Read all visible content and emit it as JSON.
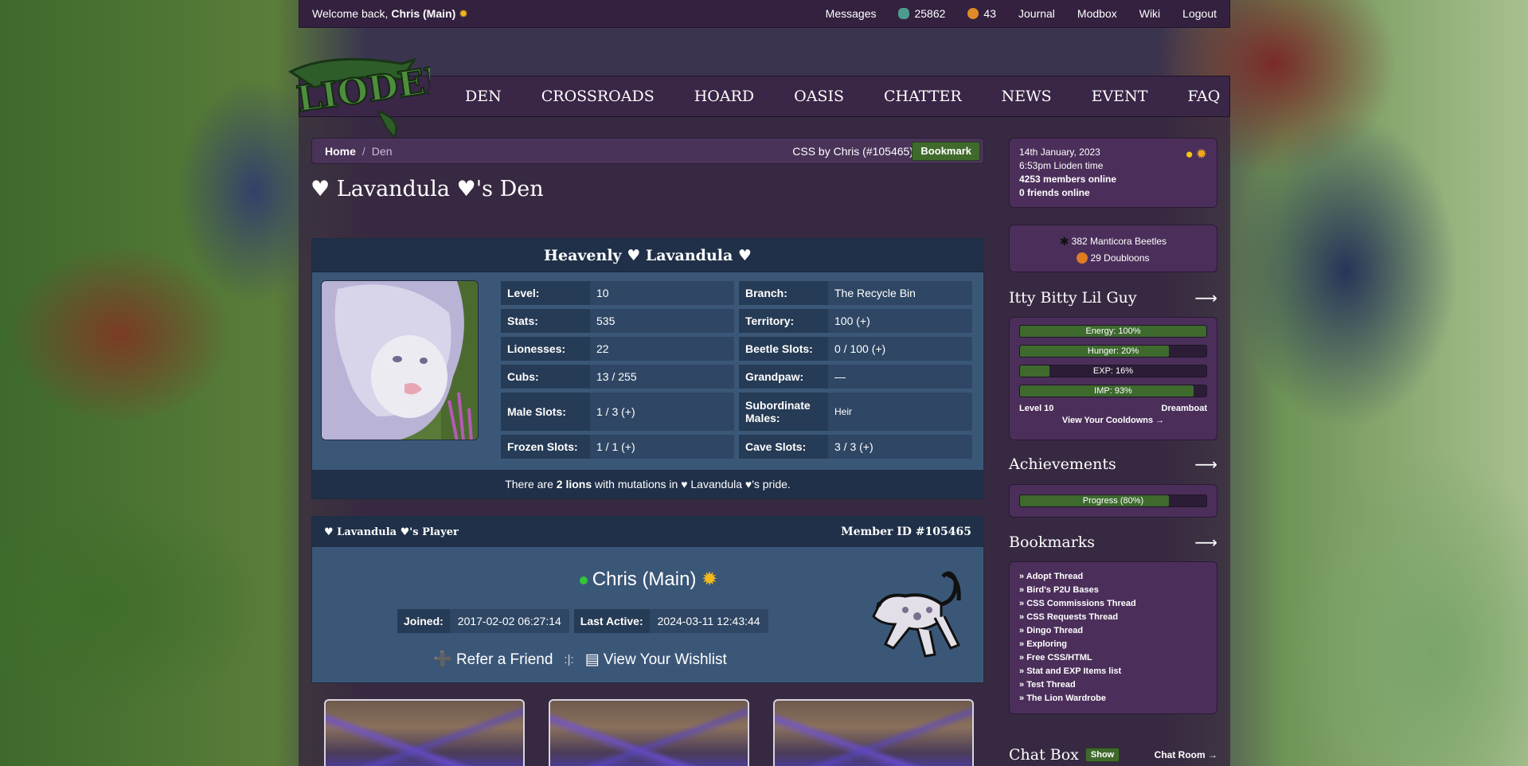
{
  "topbar": {
    "welcome_prefix": "Welcome back,",
    "user": "Chris (Main)",
    "messages": "Messages",
    "beetles": "25862",
    "doubloons": "43",
    "journal": "Journal",
    "modbox": "Modbox",
    "wiki": "Wiki",
    "logout": "Logout"
  },
  "logo_text": "LIODEN",
  "nav": [
    "DEN",
    "CROSSROADS",
    "HOARD",
    "OASIS",
    "CHATTER",
    "NEWS",
    "EVENT",
    "FAQ"
  ],
  "breadcrumb": {
    "home": "Home",
    "separator": "/",
    "current": "Den",
    "css_credit": "CSS by Chris (#105465)",
    "bookmark": "Bookmark"
  },
  "page_title": "♥ Lavandula ♥'s Den",
  "den": {
    "heading": "Heavenly ♥ Lavandula ♥",
    "stats": [
      {
        "label": "Level:",
        "value": "10"
      },
      {
        "label": "Branch:",
        "value": "The Recycle Bin"
      },
      {
        "label": "Stats:",
        "value": "535"
      },
      {
        "label": "Territory:",
        "value": "100 (+)"
      },
      {
        "label": "Lionesses:",
        "value": "22"
      },
      {
        "label": "Beetle Slots:",
        "value": "0 / 100 (+)"
      },
      {
        "label": "Cubs:",
        "value": "13 / 255"
      },
      {
        "label": "Grandpaw:",
        "value": "—"
      },
      {
        "label": "Male Slots:",
        "value": "1 / 3 (+)"
      },
      {
        "label": "Subordinate Males:",
        "value": "Heir"
      },
      {
        "label": "Frozen Slots:",
        "value": "1 / 1 (+)"
      },
      {
        "label": "Cave Slots:",
        "value": "3 / 3 (+)"
      }
    ],
    "mutation_pre": "There are",
    "mutation_count": "2 lions",
    "mutation_post": "with mutations in ♥ Lavandula ♥'s pride."
  },
  "player": {
    "heading": "♥ Lavandula ♥'s Player",
    "member_id": "Member ID #105465",
    "name": "Chris (Main)",
    "joined_label": "Joined:",
    "joined": "2017-02-02 06:27:14",
    "active_label": "Last Active:",
    "active": "2024-03-11 12:43:44",
    "refer": "Refer a Friend",
    "separator": ":|:",
    "wishlist": "View Your Wishlist"
  },
  "sidebar": {
    "date": "14th January, 2023",
    "time": "6:53pm Lioden time",
    "members_online": "4253 members online",
    "friends_online": "0 friends online",
    "beetles": "382 Manticora Beetles",
    "doubloons": "29 Doubloons",
    "pet_title": "Itty Bitty Lil Guy",
    "bars": [
      {
        "label": "Energy: 100%",
        "value": 100
      },
      {
        "label": "Hunger: 20%",
        "value": 80
      },
      {
        "label": "EXP: 16%",
        "value": 16
      },
      {
        "label": "IMP: 93%",
        "value": 93
      }
    ],
    "pet_level": "Level 10",
    "pet_status": "Dreamboat",
    "cooldowns": "View Your Cooldowns →",
    "achievements_title": "Achievements",
    "achievements_bar": {
      "label": "Progress (80%)",
      "value": 80
    },
    "bookmarks_title": "Bookmarks",
    "bookmarks": [
      "Adopt Thread",
      "Bird's P2U Bases",
      "CSS Commissions Thread",
      "CSS Requests Thread",
      "Dingo Thread",
      "Exploring",
      "Free CSS/HTML",
      "Stat and EXP Items list",
      "Test Thread",
      "The Lion Wardrobe"
    ],
    "chat_title": "Chat Box",
    "chat_show": "Show",
    "chat_room": "Chat Room →",
    "arrow": "⟶"
  },
  "colors": {
    "accent_green": "#3f6a2b",
    "panel_blue": "#3b5778",
    "sidebar_purple": "#4b2f5a",
    "online_dot": "#33c637"
  }
}
